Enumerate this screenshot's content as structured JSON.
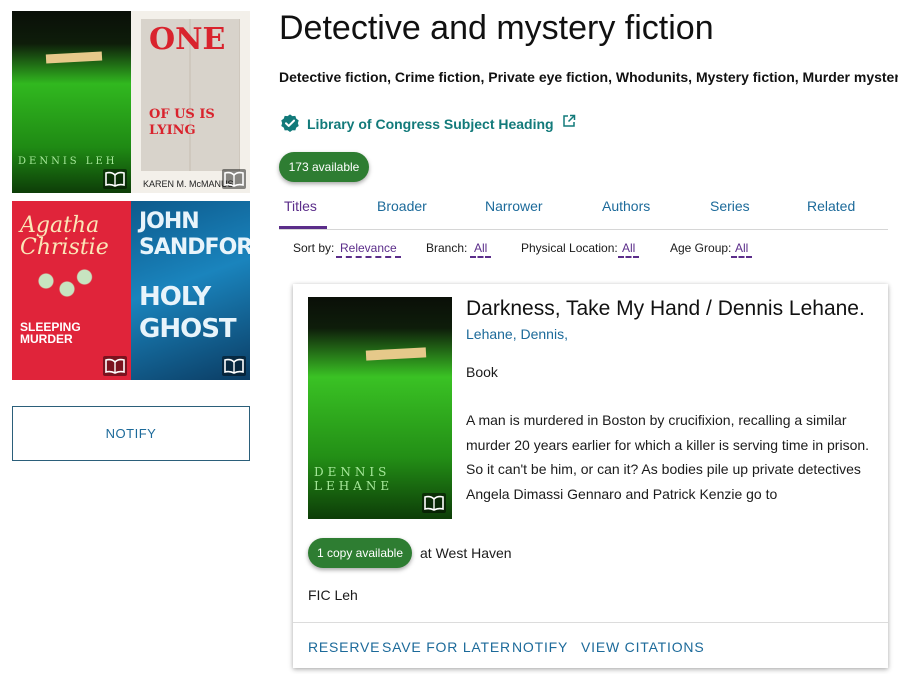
{
  "left": {
    "covers": [
      {
        "author": "DENNIS LEH",
        "tag": "darkness, take my hand"
      },
      {
        "title_art": "ONE",
        "title_art2": "OF US IS LYING",
        "author": "KAREN M. McMANUS"
      },
      {
        "author": "Agatha Christie",
        "title": "SLEEPING MURDER"
      },
      {
        "author": "JOHN SANDFORD",
        "title": "HOLY GHOST"
      }
    ],
    "notify_label": "NOTIFY"
  },
  "header": {
    "title": "Detective and mystery fiction",
    "subtitle": "Detective fiction, Crime fiction, Private eye fiction, Whodunits, Mystery fiction, Murder mysteries",
    "loc_link": "Library of Congress Subject Heading",
    "available": "173 available"
  },
  "tabs": [
    "Titles",
    "Broader",
    "Narrower",
    "Authors",
    "Series",
    "Related"
  ],
  "active_tab": "Titles",
  "filters": {
    "sort_label": "Sort by:",
    "sort_value": "Relevance",
    "branch_label": "Branch:",
    "branch_value": "All",
    "location_label": "Physical Location:",
    "location_value": "All",
    "age_label": "Age Group:",
    "age_value": "All"
  },
  "result": {
    "cover_author": "DENNIS LEHANE",
    "cover_tag": "darkness, take my hand",
    "title": "Darkness, Take My Hand / Dennis Lehane.",
    "author": "Lehane, Dennis,",
    "format": "Book",
    "description": "A man is murdered in Boston by crucifixion, recalling a similar murder 20 years earlier for which a killer is serving time in prison. So it can't be him, or can it? As bodies pile up private detectives Angela Dimassi Gennaro and Patrick Kenzie go to",
    "copy_available": "1 copy available",
    "at_text": "at  West Haven",
    "call_number": "FIC Leh",
    "actions": [
      "RESERVE",
      "SAVE FOR LATER",
      "NOTIFY",
      "VIEW CITATIONS"
    ]
  },
  "colors": {
    "accent_purple": "#5b2d8a",
    "link_blue": "#1c6a9a",
    "available_green": "#2e7d32",
    "loc_teal": "#127a7a"
  },
  "icons": [
    "verified-check-icon",
    "external-link-icon",
    "open-book-icon"
  ]
}
